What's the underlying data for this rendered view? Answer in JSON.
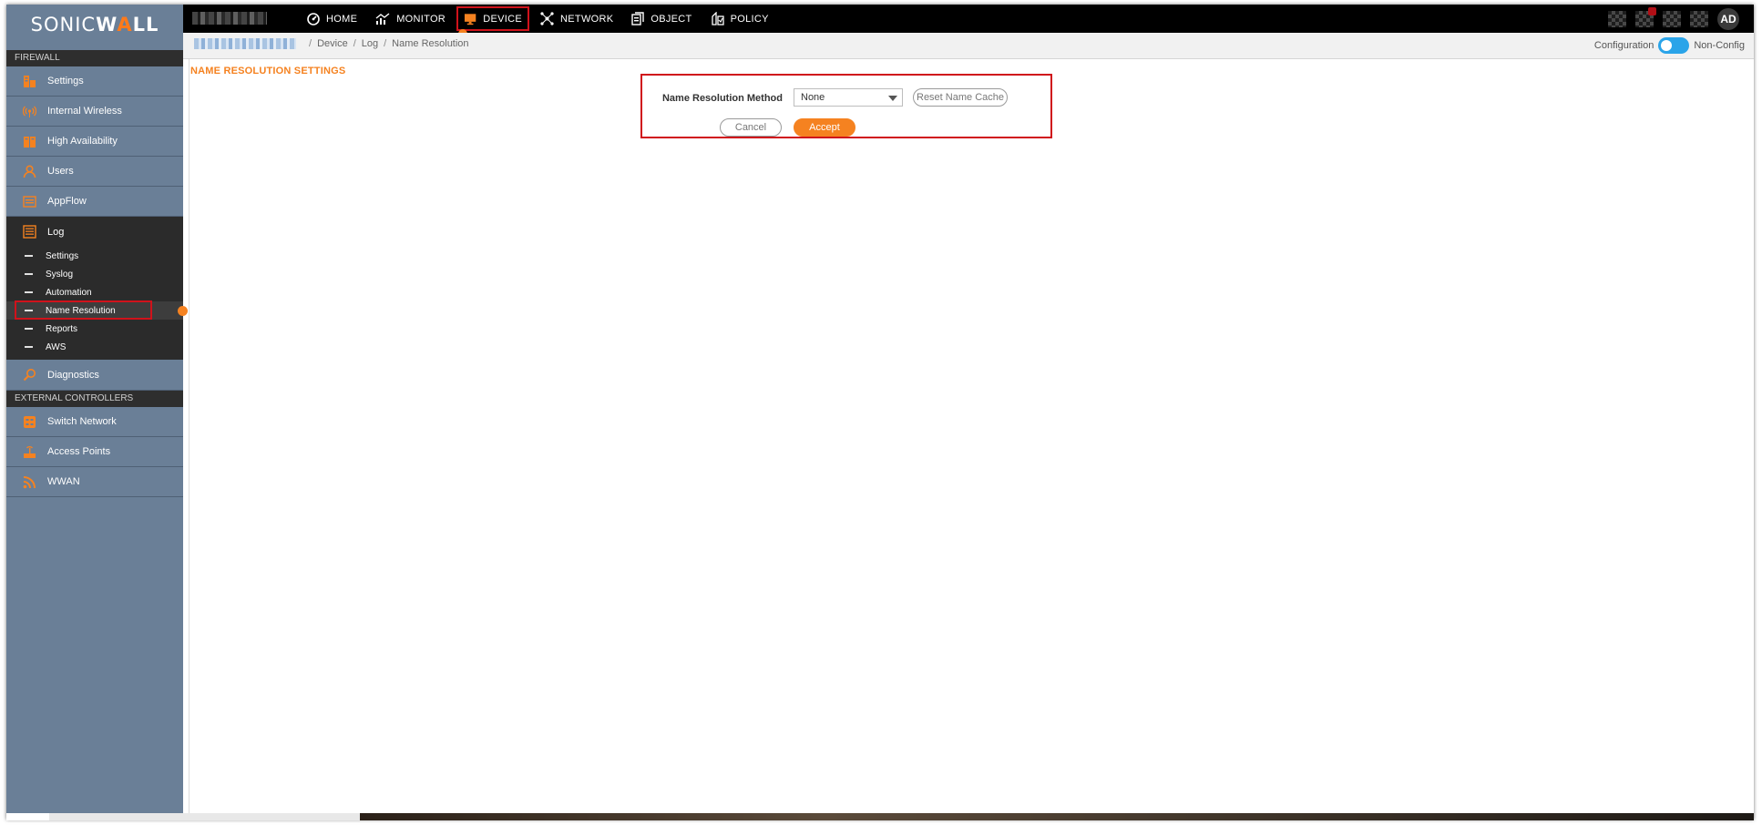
{
  "brand": {
    "sonic": "SONIC",
    "w": "W",
    "accent_a": "A",
    "ll": "LL",
    "accent_color": "#f58220"
  },
  "topnav": {
    "items": [
      {
        "label": "HOME",
        "icon": "dashboard-gauge-icon"
      },
      {
        "label": "MONITOR",
        "icon": "chart-icon"
      },
      {
        "label": "DEVICE",
        "icon": "monitor-icon"
      },
      {
        "label": "NETWORK",
        "icon": "network-nodes-icon"
      },
      {
        "label": "OBJECT",
        "icon": "object-icon"
      },
      {
        "label": "POLICY",
        "icon": "policy-icon"
      }
    ],
    "active": "DEVICE"
  },
  "user": {
    "initials": "AD"
  },
  "sidebar": {
    "firewall_header": "FIREWALL",
    "items": [
      {
        "label": "Settings",
        "icon": "settings-device-icon"
      },
      {
        "label": "Internal Wireless",
        "icon": "wireless-icon"
      },
      {
        "label": "High Availability",
        "icon": "high-availability-icon"
      },
      {
        "label": "Users",
        "icon": "user-icon"
      },
      {
        "label": "AppFlow",
        "icon": "appflow-icon"
      }
    ],
    "log": {
      "label": "Log",
      "icon": "log-icon",
      "sub_items": [
        "Settings",
        "Syslog",
        "Automation",
        "Name Resolution",
        "Reports",
        "AWS"
      ],
      "active": "Name Resolution"
    },
    "diagnostics": {
      "label": "Diagnostics",
      "icon": "diagnostics-icon"
    },
    "external_header": "EXTERNAL CONTROLLERS",
    "external_items": [
      {
        "label": "Switch Network",
        "icon": "switch-network-icon"
      },
      {
        "label": "Access Points",
        "icon": "access-point-icon"
      },
      {
        "label": "WWAN",
        "icon": "wwan-icon"
      }
    ]
  },
  "breadcrumb": [
    "Device",
    "Log",
    "Name Resolution"
  ],
  "mode": {
    "left_label": "Configuration",
    "right_label": "Non-Config"
  },
  "page": {
    "section_title": "NAME RESOLUTION SETTINGS",
    "method_label": "Name Resolution Method",
    "method_value": "None",
    "reset_label": "Reset Name Cache",
    "cancel_label": "Cancel",
    "accept_label": "Accept"
  }
}
